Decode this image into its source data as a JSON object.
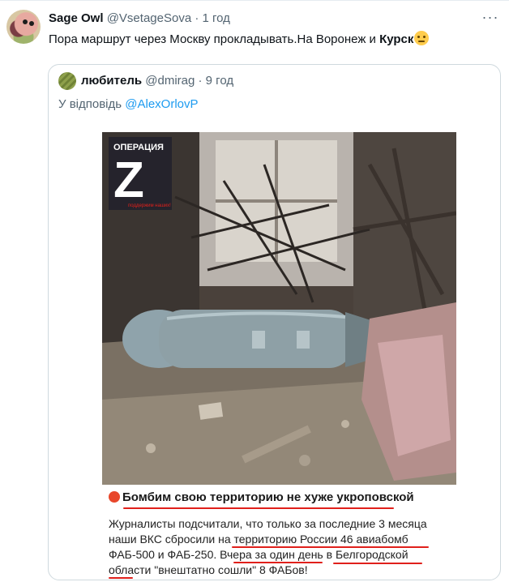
{
  "tweet": {
    "author_name": "Sage Owl",
    "handle": "@VsetageSova",
    "separator": "·",
    "time": "1 год",
    "text_main": "Пора маршрут через Москву прокладывать.На Воронеж и ",
    "text_bold": "Курск",
    "emoji_icon": "face-with-rolling-eyes"
  },
  "quoted": {
    "author_name": "любитель",
    "handle": "@dmirag",
    "separator": "·",
    "time": "9 год",
    "reply_prefix": "У відповідь ",
    "reply_mention": "@AlexOrlovP"
  },
  "image": {
    "logo_top": "ОПЕРАЦИЯ",
    "logo_letter": "Z",
    "logo_sub": "поддержим наших!",
    "caption_title": "Бомбим свою территорию не хуже укроповской",
    "caption_lines": [
      "Журналисты подсчитали, что только за последние 3 месяца",
      "наши ВКС сбросили на территорию России 46 авиабомб",
      "ФАБ-500 и ФАБ-250. Вчера за один день в Белгородской",
      "области \"внештатно сошли\" 8 ФАБов!"
    ]
  },
  "colors": {
    "text": "#0f1419",
    "secondary": "#536471",
    "link": "#1d9bf0",
    "border": "#cfd9de",
    "underline": "#e0201b"
  }
}
